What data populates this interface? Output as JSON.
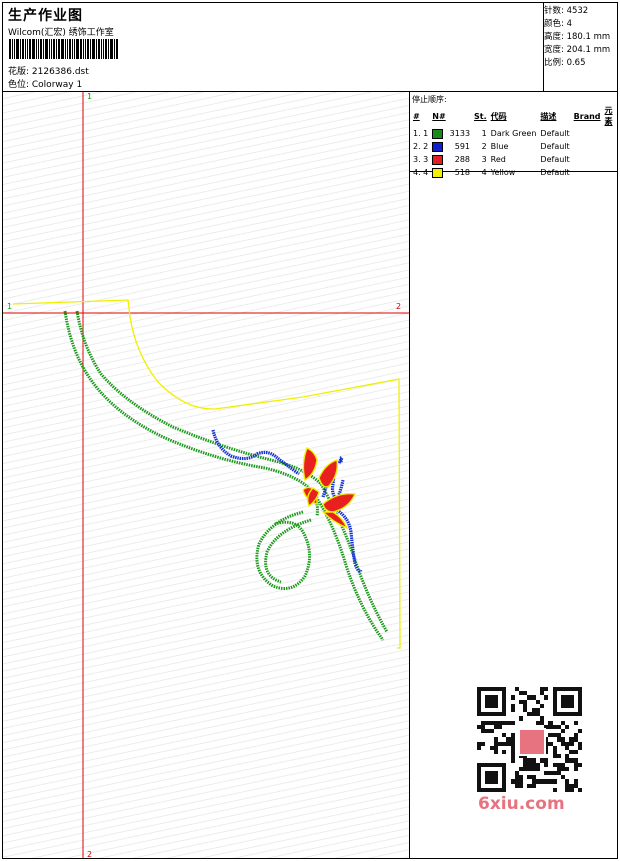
{
  "header": {
    "title": "生产作业图",
    "subtitle": "Wilcom(汇宏) 绣饰工作室",
    "file_line": "花版: 2126386.dst",
    "colorway_line": "色位: Colorway 1"
  },
  "stats": {
    "stitches": "针数: 4532",
    "colors": "颜色: 4",
    "height": "高度: 180.1 mm",
    "width": "宽度: 204.1 mm",
    "scale": "比例: 0.65"
  },
  "stop_sequence": {
    "title": "停止顺序:",
    "headers": [
      "#",
      "N#",
      "St.",
      "代码",
      "描述",
      "Brand",
      "元素"
    ],
    "rows": [
      {
        "idx": "1. 1",
        "color": "#1a8a1a",
        "st": "3133",
        "code": "1",
        "desc": "Dark Green",
        "brand": "Default"
      },
      {
        "idx": "2. 2",
        "color": "#1020d0",
        "st": "591",
        "code": "2",
        "desc": "Blue",
        "brand": "Default"
      },
      {
        "idx": "3. 3",
        "color": "#e02020",
        "st": "288",
        "code": "3",
        "desc": "Red",
        "brand": "Default"
      },
      {
        "idx": "4. 4",
        "color": "#f0f000",
        "st": "518",
        "code": "4",
        "desc": "Yellow",
        "brand": "Default"
      }
    ]
  },
  "markers": {
    "v_top": "1",
    "v_bottom": "2",
    "h_left": "1",
    "h_right": "2"
  },
  "watermark": {
    "logo": "6xiu.com"
  },
  "colors": {
    "guide_red": "#e00000",
    "outline_yellow": "#f0f000",
    "green": "#1a9a1a",
    "blue": "#1530d8",
    "red": "#e82020"
  }
}
